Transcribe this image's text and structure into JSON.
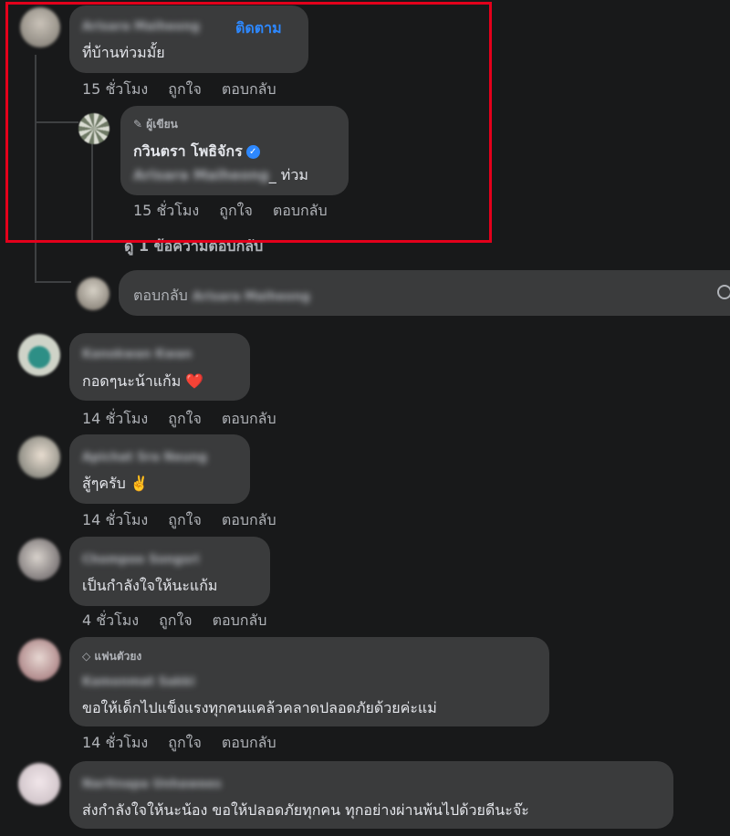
{
  "comments": [
    {
      "author": "Arisara Maiheong",
      "follow": "ติดตาม",
      "text": "ที่บ้านท่วมมั้ย",
      "time": "15 ชั่วโมง",
      "like": "ถูกใจ",
      "reply": "ตอบกลับ"
    },
    {
      "author": "Kanokwan Kwan",
      "text": "กอดๆนะน้าแก้ม",
      "time": "14 ชั่วโมง",
      "like": "ถูกใจ",
      "reply": "ตอบกลับ"
    },
    {
      "author": "Apichat Sra Neung",
      "text": "สู้ๆครับ",
      "time": "14 ชั่วโมง",
      "like": "ถูกใจ",
      "reply": "ตอบกลับ"
    },
    {
      "author": "Chompoo Songsri",
      "text": "เป็นกำลังใจให้นะแก้ม",
      "time": "4 ชั่วโมง",
      "like": "ถูกใจ",
      "reply": "ตอบกลับ"
    },
    {
      "badge": "แฟนตัวยง",
      "author": "Kamonmat Sakki",
      "text": "ขอให้เด็กไปแข็งแรงทุกคนแคล้วคลาดปลอดภัยด้วยค่ะแม่",
      "time": "14 ชั่วโมง",
      "like": "ถูกใจ",
      "reply": "ตอบกลับ"
    },
    {
      "author": "Naritnapa Unhawees",
      "text": "ส่งกำลังใจให้นะน้อง ขอให้ปลอดภัยทุกคน ทุกอย่างผ่านพ้นไปด้วยดีนะจ๊ะ"
    }
  ],
  "reply": {
    "badge": "ผู้เขียน",
    "author": "กวินตรา โพธิจักร",
    "mention": "Arisara Maiheong",
    "text": "_ ท่วม",
    "time": "15 ชั่วโมง",
    "like": "ถูกใจ",
    "reply": "ตอบกลับ"
  },
  "replies_link": "ดู 1 ข้อความตอบกลับ",
  "reply_box": {
    "label": "ตอบกลับ",
    "mention": "Arisara Maiheong"
  },
  "emoji": {
    "heart": "❤️",
    "victory": "✌️"
  },
  "colors": {
    "highlight_border": "#e3001b",
    "link": "#2d88ff",
    "bubble": "#3a3b3c",
    "background": "#18191a"
  }
}
